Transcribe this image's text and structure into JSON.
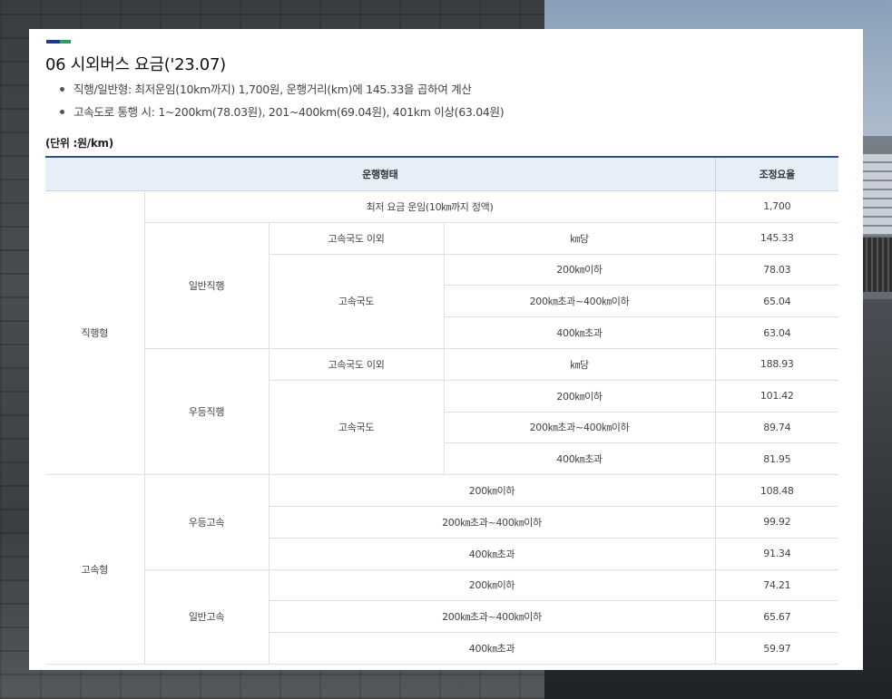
{
  "page": {
    "title": "06 시외버스 요금('23.07)",
    "bullets": [
      "직행/일반형: 최저운임(10km까지) 1,700원, 운행거리(km)에 145.33을 곱하여 계산",
      "고속도로 통행 시: 1~200km(78.03원), 201~400km(69.04원), 401km 이상(63.04원)"
    ],
    "unit": "(단위 :원/km)"
  },
  "table": {
    "headers": {
      "type": "운행형태",
      "fare": "조정요율"
    },
    "min_fare": {
      "label": "최저 요금 운임(10㎞까지 정액)",
      "value": "1,700"
    },
    "groups": {
      "direct": "직행형",
      "express": "고속형"
    },
    "subgroups": {
      "general_direct": "일반직행",
      "premium_direct": "우등직행",
      "premium_express": "우등고속",
      "general_express": "일반고속"
    },
    "road": {
      "non_highway": "고속국도 이외",
      "highway": "고속국도"
    },
    "distance": {
      "per_km": "㎞당",
      "under200": "200㎞이하",
      "mid": "200㎞초과~400㎞이하",
      "over400": "400㎞초과"
    },
    "values": {
      "general_direct": [
        "145.33",
        "78.03",
        "65.04",
        "63.04"
      ],
      "premium_direct": [
        "188.93",
        "101.42",
        "89.74",
        "81.95"
      ],
      "premium_express": [
        "108.48",
        "99.92",
        "91.34"
      ],
      "general_express": [
        "74.21",
        "65.67",
        "59.97"
      ]
    }
  }
}
